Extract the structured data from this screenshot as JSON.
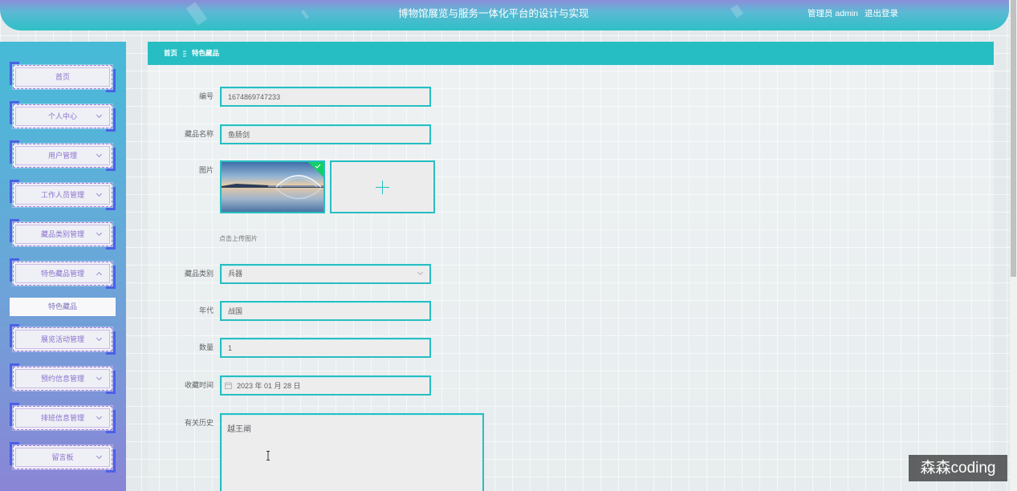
{
  "theme": {
    "accent": "#26bec3",
    "header_top": "#8c8ed9",
    "header_bottom": "#2ec1c6",
    "sidebar_top": "#45bbd7",
    "sidebar_bottom": "#8a85d6",
    "bracket": "#4b60e5",
    "frame": "#a676dc",
    "menu_text": "#8c72cf"
  },
  "header": {
    "title": "博物馆展览与服务一体化平台的设计与实现",
    "user": "管理员 admin",
    "logout": "退出登录"
  },
  "sidebar": {
    "items": [
      {
        "label": "首页"
      },
      {
        "label": "个人中心",
        "icon": "chevron-down-icon"
      },
      {
        "label": "用户管理",
        "icon": "chevron-down-icon"
      },
      {
        "label": "工作人员管理",
        "icon": "chevron-down-icon"
      },
      {
        "label": "藏品类别管理",
        "icon": "chevron-down-icon"
      },
      {
        "label": "特色藏品管理",
        "icon": "chevron-up-icon"
      },
      {
        "label": "展览活动管理",
        "icon": "chevron-down-icon"
      },
      {
        "label": "预约信息管理",
        "icon": "chevron-down-icon"
      },
      {
        "label": "排班信息管理",
        "icon": "chevron-down-icon"
      },
      {
        "label": "留言板",
        "icon": "chevron-down-icon"
      }
    ],
    "active_submenu": {
      "label": "特色藏品"
    }
  },
  "breadcrumb": {
    "home": "首页",
    "separator_icon": "menu-icon",
    "current": "特色藏品"
  },
  "form": {
    "id": {
      "label": "编号",
      "value": "1674869747233"
    },
    "name": {
      "label": "藏品名称",
      "value": "鱼肠剑"
    },
    "image": {
      "label": "图片",
      "hint": "点击上传图片",
      "upload_icon": "plus-icon",
      "status_icon": "success-check-icon"
    },
    "category": {
      "label": "藏品类别",
      "value": "兵器"
    },
    "era": {
      "label": "年代",
      "value": "战国"
    },
    "quantity": {
      "label": "数量",
      "value": "1"
    },
    "collect_time": {
      "label": "收藏时间",
      "value": "2023 年 01 月 28 日",
      "icon": "calendar-icon"
    },
    "history": {
      "label": "有关历史",
      "value": "越王阐"
    }
  },
  "watermark": {
    "text": "森森coding"
  }
}
